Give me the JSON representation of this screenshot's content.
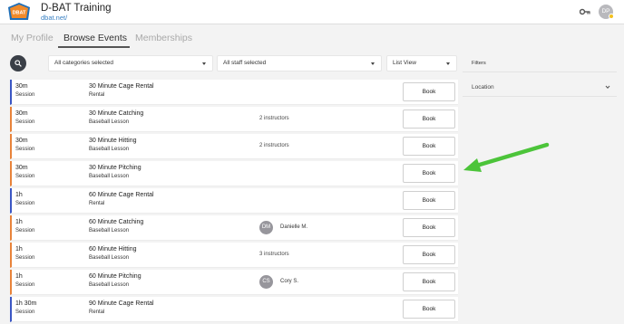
{
  "header": {
    "app_title": "D-BAT Training",
    "app_url": "dbat.net/",
    "logo_text": "DBAT",
    "avatar_initials": "DP",
    "icons": [
      "logo",
      "key-icon",
      "avatar"
    ]
  },
  "tabs": [
    {
      "label": "My Profile",
      "active": false
    },
    {
      "label": "Browse Events",
      "active": true
    },
    {
      "label": "Memberships",
      "active": false
    }
  ],
  "filters_bar": {
    "search_icon": "search-icon",
    "categories": "All categories selected",
    "staff": "All staff selected",
    "view": "List View"
  },
  "sidebar": {
    "heading": "Filters",
    "location_label": "Location"
  },
  "colors": {
    "session_bar": "#3b57c4",
    "lesson_bar": "#e8833a",
    "arrow": "#4cc43a",
    "search_button": "#3a3f47"
  },
  "book_label": "Book",
  "events": [
    {
      "duration": "30m",
      "type": "Session",
      "name": "30 Minute Cage Rental",
      "category": "Rental",
      "bar": "session",
      "instructor_text": "",
      "instructor_initials": "",
      "instructor_name": ""
    },
    {
      "duration": "30m",
      "type": "Session",
      "name": "30 Minute Catching",
      "category": "Baseball Lesson",
      "bar": "lesson",
      "instructor_text": "2 instructors",
      "instructor_initials": "",
      "instructor_name": ""
    },
    {
      "duration": "30m",
      "type": "Session",
      "name": "30 Minute Hitting",
      "category": "Baseball Lesson",
      "bar": "lesson",
      "instructor_text": "2 instructors",
      "instructor_initials": "",
      "instructor_name": ""
    },
    {
      "duration": "30m",
      "type": "Session",
      "name": "30 Minute Pitching",
      "category": "Baseball Lesson",
      "bar": "lesson",
      "instructor_text": "",
      "instructor_initials": "",
      "instructor_name": ""
    },
    {
      "duration": "1h",
      "type": "Session",
      "name": "60 Minute Cage Rental",
      "category": "Rental",
      "bar": "session",
      "instructor_text": "",
      "instructor_initials": "",
      "instructor_name": ""
    },
    {
      "duration": "1h",
      "type": "Session",
      "name": "60 Minute Catching",
      "category": "Baseball Lesson",
      "bar": "lesson",
      "instructor_text": "",
      "instructor_initials": "DM",
      "instructor_name": "Danielle M."
    },
    {
      "duration": "1h",
      "type": "Session",
      "name": "60 Minute Hitting",
      "category": "Baseball Lesson",
      "bar": "lesson",
      "instructor_text": "3 instructors",
      "instructor_initials": "",
      "instructor_name": ""
    },
    {
      "duration": "1h",
      "type": "Session",
      "name": "60 Minute Pitching",
      "category": "Baseball Lesson",
      "bar": "lesson",
      "instructor_text": "",
      "instructor_initials": "CS",
      "instructor_name": "Cory S."
    },
    {
      "duration": "1h 30m",
      "type": "Session",
      "name": "90 Minute Cage Rental",
      "category": "Rental",
      "bar": "session",
      "instructor_text": "",
      "instructor_initials": "",
      "instructor_name": ""
    }
  ]
}
